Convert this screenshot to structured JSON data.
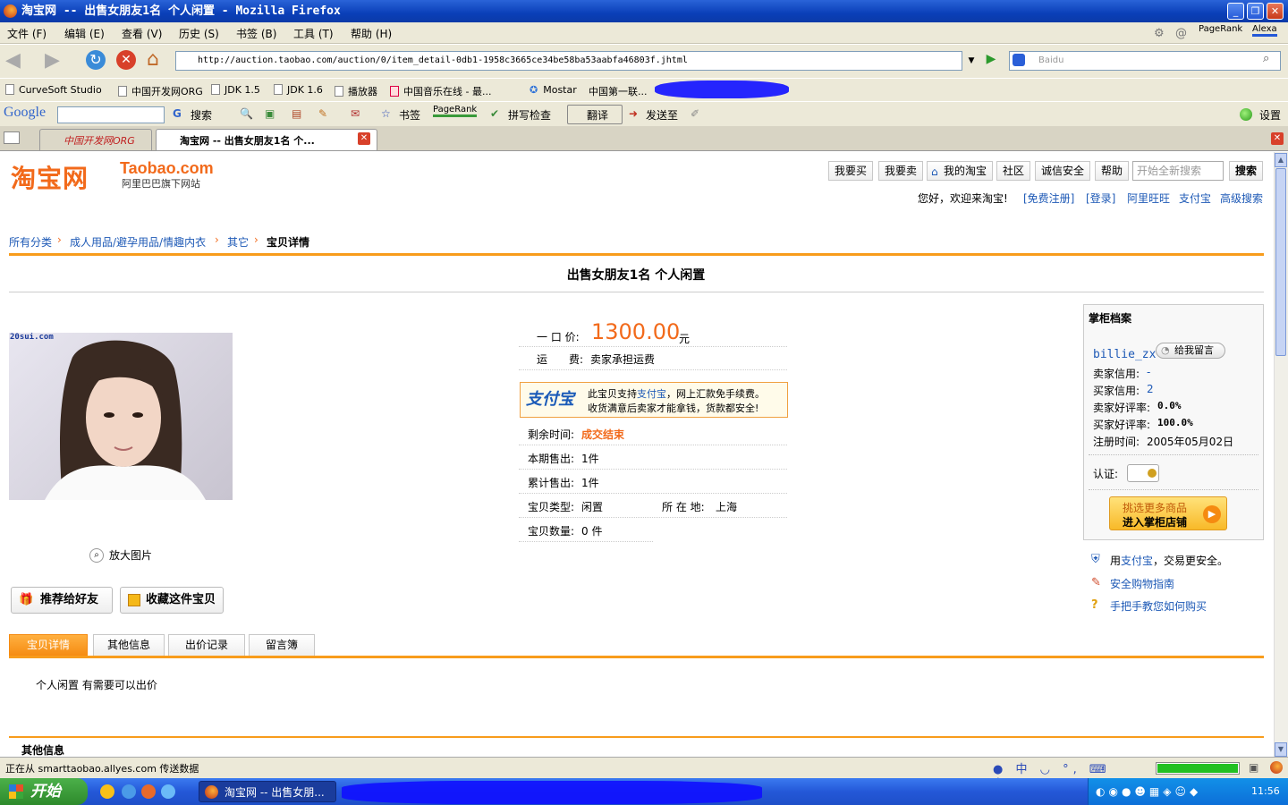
{
  "window": {
    "title": "淘宝网 -- 出售女朋友1名 个人闲置 - Mozilla Firefox",
    "min": "_",
    "max": "❐",
    "close": "✕"
  },
  "menu": [
    "文件 (F)",
    "编辑 (E)",
    "查看 (V)",
    "历史 (S)",
    "书签 (B)",
    "工具 (T)",
    "帮助 (H)"
  ],
  "menu_right": {
    "pagerank": "PageRank",
    "alexa": "Alexa"
  },
  "nav": {
    "url": "http://auction.taobao.com/auction/0/item_detail-0db1-1958c3665ce34be58ba53aabfa46803f.jhtml",
    "search_placeholder": "Baidu"
  },
  "bookmarks": [
    "CurveSoft Studio",
    "中国开发网ORG",
    "JDK 1.5",
    "JDK 1.6",
    "播放器",
    "中国音乐在线 - 最...",
    "Mostar",
    "中国第一联..."
  ],
  "google_toolbar": {
    "logo": "Google",
    "search": "搜索",
    "bookmarks": "书签",
    "pagerank": "PageRank",
    "spell": "拼写检查",
    "translate": "翻译",
    "send": "发送至",
    "settings": "设置"
  },
  "tabs": [
    {
      "label": "中国开发网ORG"
    },
    {
      "label": "淘宝网 -- 出售女朋友1名 个..."
    }
  ],
  "taobao": {
    "logo_cn": "淘宝网",
    "logo_en": "Taobao.com",
    "logo_sub": "阿里巴巴旗下网站",
    "top_buttons": [
      "我要买",
      "我要卖",
      "我的淘宝",
      "社区",
      "诚信安全",
      "帮助"
    ],
    "search_placeholder": "开始全新搜索",
    "search_btn": "搜索",
    "welcome": "您好，欢迎来淘宝!",
    "register": "[免费注册]",
    "login": "[登录]",
    "links": [
      "阿里旺旺",
      "支付宝",
      "高级搜索"
    ],
    "breadcrumb": [
      "所有分类",
      "成人用品/避孕用品/情趣内衣",
      "其它",
      "宝贝详情"
    ],
    "item_title": "出售女朋友1名 个人闲置",
    "photo_watermark": "20sui.com",
    "zoom": "放大图片",
    "recommend": "推荐给好友",
    "favorite": "收藏这件宝贝",
    "price_label": "一 口 价:",
    "price": "1300.00",
    "price_unit": "元",
    "shipping_label": "运　　费:",
    "shipping": "卖家承担运费",
    "alipay_logo": "支付宝",
    "alipay_line1a": "此宝贝支持",
    "alipay_line1b": "支付宝",
    "alipay_line1c": "，网上汇款免手续费。",
    "alipay_line2": "收货满意后卖家才能拿钱，货款都安全!",
    "remain_label": "剩余时间:",
    "remain": "成交结束",
    "period_label": "本期售出:",
    "period": "1件",
    "total_label": "累计售出:",
    "total": "1件",
    "type_label": "宝贝类型:",
    "type": "闲置",
    "location_label": "所 在 地:",
    "location": "上海",
    "qty_label": "宝贝数量:",
    "qty": "0 件",
    "seller_panel": {
      "title": "掌柜档案",
      "name": "billie_zx",
      "message": "给我留言",
      "seller_credit_label": "卖家信用:",
      "seller_credit": "-",
      "buyer_credit_label": "买家信用:",
      "buyer_credit": "2",
      "seller_rate_label": "卖家好评率:",
      "seller_rate": "0.0%",
      "buyer_rate_label": "买家好评率:",
      "buyer_rate": "100.0%",
      "reg_label": "注册时间:",
      "reg": "2005年05月02日",
      "cert_label": "认证:",
      "shop_btn1": "挑选更多商品",
      "shop_btn2": "进入掌柜店铺"
    },
    "safety": [
      {
        "pre": "用",
        "link": "支付宝",
        "post": "，交易更安全。"
      },
      {
        "link": "安全购物指南"
      },
      {
        "link": "手把手教您如何购买"
      }
    ],
    "detail_tabs": [
      "宝贝详情",
      "其他信息",
      "出价记录",
      "留言簿"
    ],
    "description": "个人闲置 有需要可以出价",
    "other_info": "其他信息"
  },
  "status": "正在从 smarttaobao.allyes.com 传送数据",
  "taskbar": {
    "start": "开始",
    "item": "淘宝网 -- 出售女朋...",
    "time": "11:56"
  },
  "colors": {
    "orange": "#f26a1b",
    "link": "#1d59b6",
    "xp_blue": "#2458d8"
  }
}
